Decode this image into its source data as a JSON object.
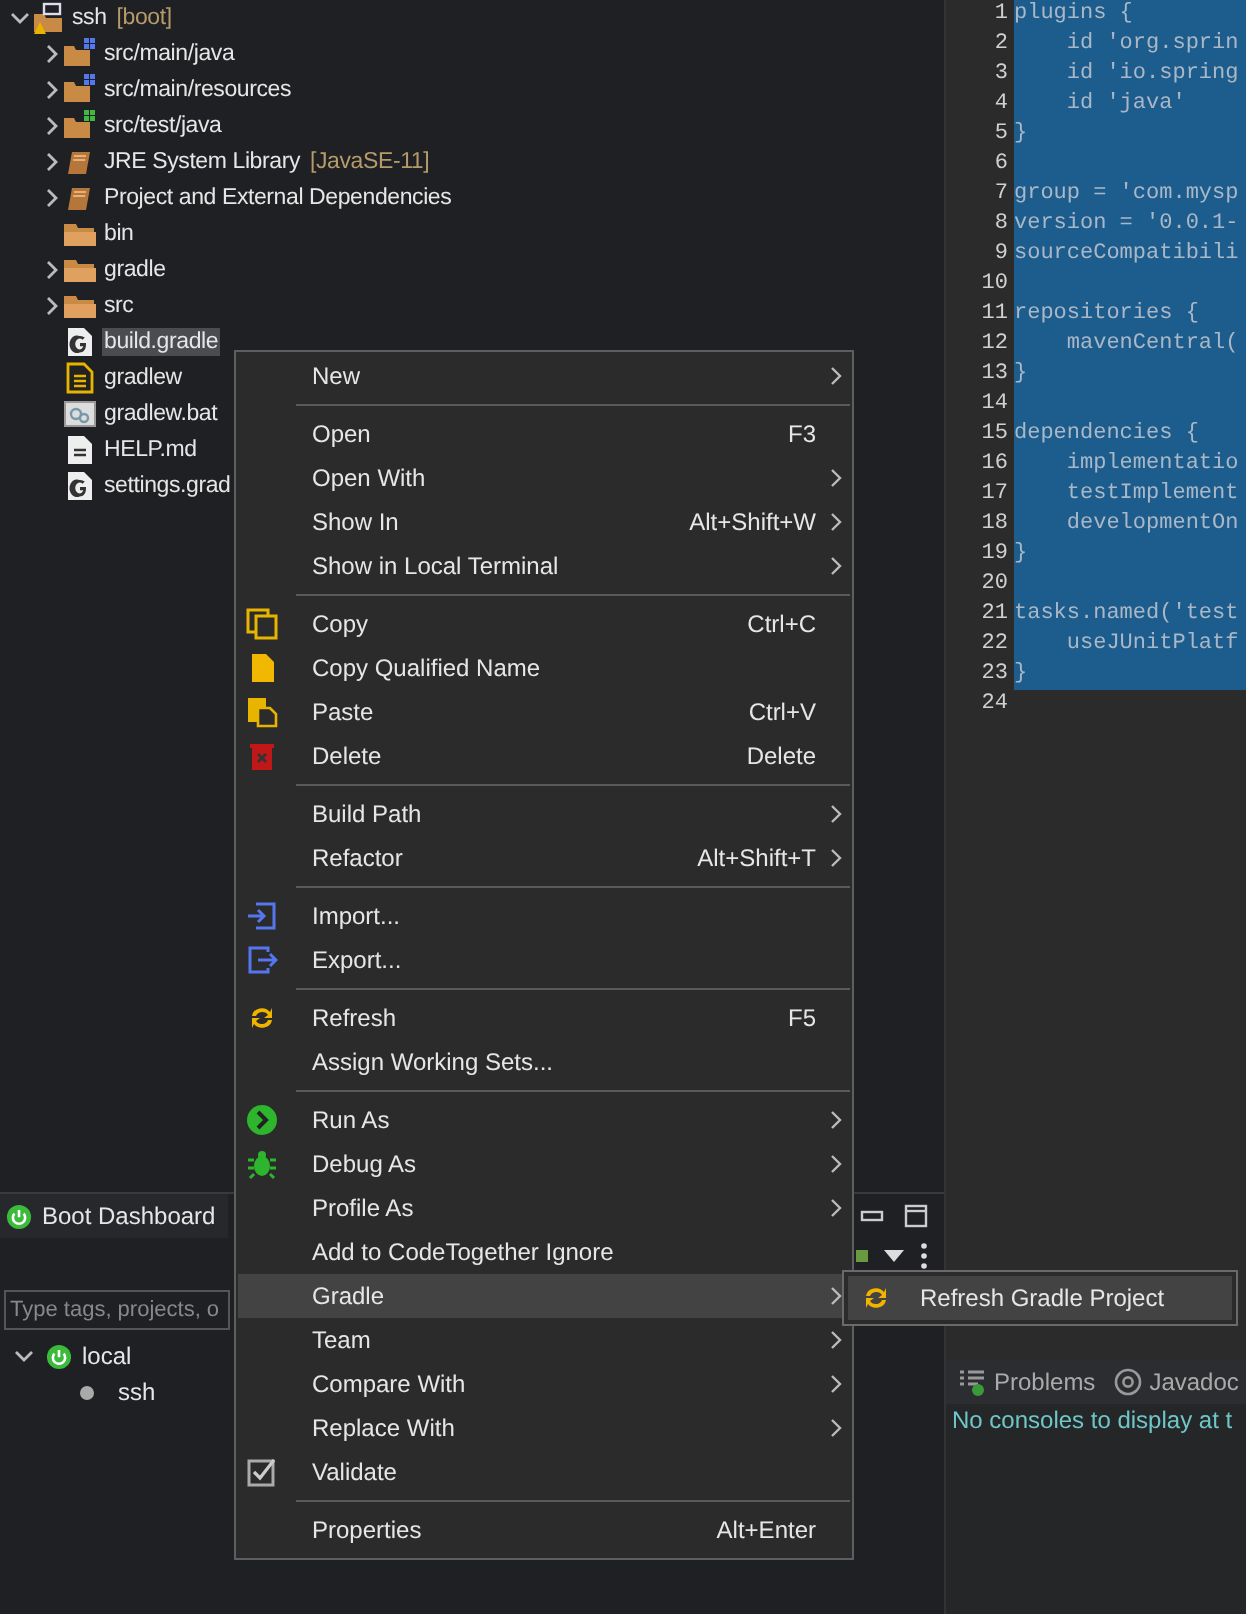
{
  "project_explorer": {
    "tree": [
      {
        "name": "ssh",
        "decoration": "[boot]",
        "kind": "project",
        "expanded": true,
        "selected": false,
        "children": [
          {
            "name": "src/main/java",
            "kind": "source-folder",
            "expanded": false,
            "selected": false
          },
          {
            "name": "src/main/resources",
            "kind": "source-folder",
            "expanded": false,
            "selected": false
          },
          {
            "name": "src/test/java",
            "kind": "test-folder",
            "expanded": false,
            "selected": false
          },
          {
            "name": "JRE System Library",
            "decoration": "[JavaSE-11]",
            "kind": "library",
            "expanded": false,
            "selected": false
          },
          {
            "name": "Project and External Dependencies",
            "kind": "library",
            "expanded": false,
            "selected": false
          },
          {
            "name": "bin",
            "kind": "folder",
            "selected": false
          },
          {
            "name": "gradle",
            "kind": "folder",
            "expanded": false,
            "selected": false
          },
          {
            "name": "src",
            "kind": "folder",
            "expanded": false,
            "selected": false
          },
          {
            "name": "build.gradle",
            "kind": "gradle-file",
            "selected": true
          },
          {
            "name": "gradlew",
            "kind": "script-file",
            "selected": false
          },
          {
            "name": "gradlew.bat",
            "kind": "bat-file",
            "selected": false
          },
          {
            "name": "HELP.md",
            "kind": "text-file",
            "selected": false
          },
          {
            "name": "settings.grad",
            "kind": "gradle-file",
            "selected": false
          }
        ]
      }
    ]
  },
  "editor": {
    "lines": [
      {
        "number": "1",
        "code": "plugins {",
        "selected": true
      },
      {
        "number": "2",
        "code": "    id 'org.sprin",
        "selected": true
      },
      {
        "number": "3",
        "code": "    id 'io.spring",
        "selected": true
      },
      {
        "number": "4",
        "code": "    id 'java'",
        "selected": true
      },
      {
        "number": "5",
        "code": "}",
        "selected": true
      },
      {
        "number": "6",
        "selected": true
      },
      {
        "number": "7",
        "code": "group = 'com.mysp",
        "selected": true
      },
      {
        "number": "8",
        "code": "version = '0.0.1-",
        "selected": true
      },
      {
        "number": "9",
        "code": "sourceCompatibili",
        "selected": true
      },
      {
        "number": "10",
        "selected": true
      },
      {
        "number": "11",
        "code": "repositories {",
        "selected": true
      },
      {
        "number": "12",
        "code": "    mavenCentral(",
        "selected": true
      },
      {
        "number": "13",
        "code": "}",
        "selected": true
      },
      {
        "number": "14",
        "selected": true
      },
      {
        "number": "15",
        "code": "dependencies {",
        "selected": true
      },
      {
        "number": "16",
        "code": "    implementatio",
        "selected": true
      },
      {
        "number": "17",
        "code": "    testImplement",
        "selected": true
      },
      {
        "number": "18",
        "code": "    developmentOn",
        "selected": true
      },
      {
        "number": "19",
        "code": "}",
        "selected": true
      },
      {
        "number": "20",
        "selected": true
      },
      {
        "number": "21",
        "code": "tasks.named('test",
        "selected": true
      },
      {
        "number": "22",
        "code": "    useJUnitPlatf",
        "selected": true
      },
      {
        "number": "23",
        "code": "}",
        "selected": true
      },
      {
        "number": "24",
        "selected": false
      }
    ]
  },
  "boot_dashboard": {
    "title": "Boot Dashboard",
    "filter": {
      "placeholder": "Type tags, projects, o"
    },
    "tree": [
      {
        "name": "local",
        "expanded": true,
        "children": [
          {
            "name": "ssh"
          }
        ]
      }
    ]
  },
  "console": {
    "tabs": [
      {
        "label": "Problems",
        "kind": "problems",
        "selected": false
      },
      {
        "label": "Javadoc",
        "kind": "javadoc",
        "selected": false
      }
    ],
    "message": "No consoles to display at t"
  },
  "context_menu": {
    "items": [
      {
        "kind": "plain",
        "label": "New",
        "submenu": true,
        "selected": false
      },
      {
        "kind": "separator"
      },
      {
        "kind": "plain",
        "label": "Open",
        "shortcut": "F3",
        "submenu": false,
        "selected": false
      },
      {
        "kind": "plain",
        "label": "Open With",
        "submenu": true,
        "selected": false
      },
      {
        "kind": "plain",
        "label": "Show In",
        "shortcut": "Alt+Shift+W",
        "submenu": true,
        "selected": false
      },
      {
        "kind": "plain",
        "label": "Show in Local Terminal",
        "submenu": true,
        "selected": false
      },
      {
        "kind": "separator"
      },
      {
        "kind": "copy",
        "label": "Copy",
        "shortcut": "Ctrl+C",
        "submenu": false,
        "selected": false
      },
      {
        "kind": "document",
        "label": "Copy Qualified Name",
        "submenu": false,
        "selected": false
      },
      {
        "kind": "paste",
        "label": "Paste",
        "shortcut": "Ctrl+V",
        "submenu": false,
        "selected": false
      },
      {
        "kind": "delete",
        "label": "Delete",
        "shortcut": "Delete",
        "submenu": false,
        "selected": false
      },
      {
        "kind": "separator"
      },
      {
        "kind": "plain",
        "label": "Build Path",
        "submenu": true,
        "selected": false
      },
      {
        "kind": "plain",
        "label": "Refactor",
        "shortcut": "Alt+Shift+T",
        "submenu": true,
        "selected": false
      },
      {
        "kind": "separator"
      },
      {
        "kind": "import",
        "label": "Import...",
        "submenu": false,
        "selected": false
      },
      {
        "kind": "export",
        "label": "Export...",
        "submenu": false,
        "selected": false
      },
      {
        "kind": "separator"
      },
      {
        "kind": "refresh",
        "label": "Refresh",
        "shortcut": "F5",
        "submenu": false,
        "selected": false
      },
      {
        "kind": "plain",
        "label": "Assign Working Sets...",
        "submenu": false,
        "selected": false
      },
      {
        "kind": "separator"
      },
      {
        "kind": "run",
        "label": "Run As",
        "submenu": true,
        "selected": false
      },
      {
        "kind": "debug",
        "label": "Debug As",
        "submenu": true,
        "selected": false
      },
      {
        "kind": "plain",
        "label": "Profile As",
        "submenu": true,
        "selected": false
      },
      {
        "kind": "plain",
        "label": "Add to CodeTogether Ignore",
        "submenu": false,
        "selected": false
      },
      {
        "kind": "plain",
        "label": "Gradle",
        "submenu": true,
        "selected": true
      },
      {
        "kind": "plain",
        "label": "Team",
        "submenu": true,
        "selected": false
      },
      {
        "kind": "plain",
        "label": "Compare With",
        "submenu": true,
        "selected": false
      },
      {
        "kind": "plain",
        "label": "Replace With",
        "submenu": true,
        "selected": false
      },
      {
        "kind": "validate",
        "label": "Validate",
        "submenu": false,
        "selected": false
      },
      {
        "kind": "separator"
      },
      {
        "kind": "plain",
        "label": "Properties",
        "shortcut": "Alt+Enter",
        "submenu": false,
        "selected": false
      }
    ]
  },
  "submenu": {
    "items": [
      {
        "label": "Refresh Gradle Project",
        "kind": "refresh",
        "selected": true
      }
    ]
  }
}
